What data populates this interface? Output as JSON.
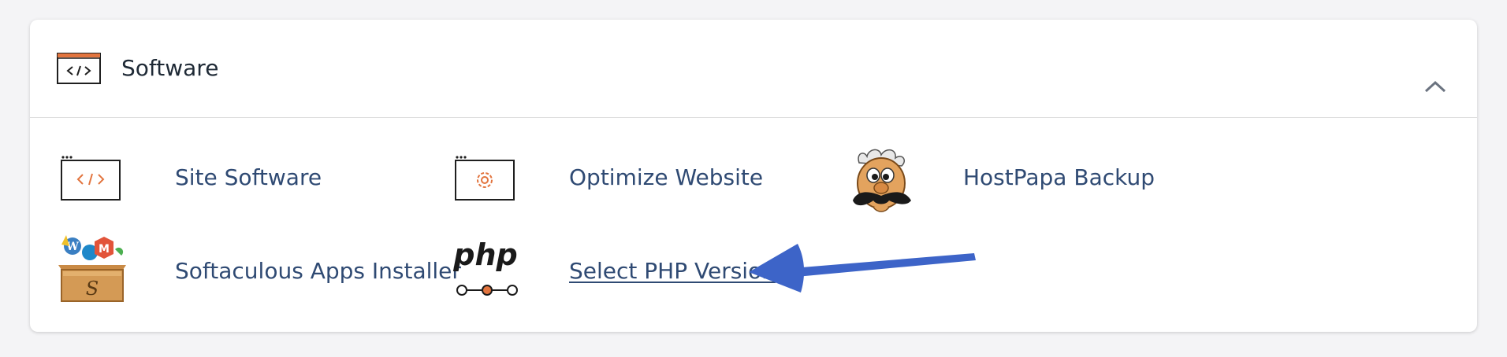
{
  "section": {
    "title": "Software",
    "icon": "code-window-icon",
    "collapse_icon": "chevron-up-icon"
  },
  "items": [
    {
      "label": "Site Software",
      "icon": "code-window-icon"
    },
    {
      "label": "Optimize Website",
      "icon": "gear-window-icon"
    },
    {
      "label": "HostPapa Backup",
      "icon": "mustache-mascot-icon"
    },
    {
      "label": "Softaculous Apps Installer",
      "icon": "softaculous-toolbox-icon"
    },
    {
      "label": "Select PHP Version",
      "icon": "php-icon",
      "php_logo_text": "php",
      "highlighted": true
    }
  ],
  "colors": {
    "accent_orange": "#e2743e",
    "link_blue": "#2f4a73",
    "arrow_blue": "#3d64c8"
  }
}
